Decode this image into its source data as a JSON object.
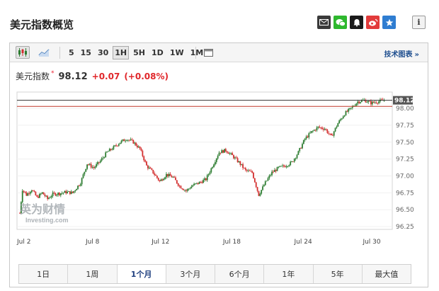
{
  "header": {
    "title": "美元指数概览"
  },
  "share_icons": [
    "email-icon",
    "wechat-icon",
    "notification-bell-icon",
    "weibo-icon",
    "favorite-star-icon"
  ],
  "info_label": "i",
  "toolbar": {
    "chart_type_icons": [
      "candlestick-icon",
      "line-chart-icon"
    ],
    "intervals": [
      "5",
      "15",
      "30",
      "1H",
      "5H",
      "1D",
      "1W",
      "1M"
    ],
    "active_interval": "1H",
    "tech_link": "技术图表",
    "tech_link_arrow": "»"
  },
  "quote": {
    "name": "美元指数",
    "marker": "*",
    "price": "98.12",
    "change": "+0.07",
    "change_pct": "(+0.08%)",
    "change_color": "#e0262a"
  },
  "watermark": {
    "line1": "英为财情",
    "line2": "Investing.com"
  },
  "range_buttons": [
    "1日",
    "1周",
    "1个月",
    "3个月",
    "6个月",
    "1年",
    "5年",
    "最大值"
  ],
  "active_range": "1个月",
  "colors": {
    "up": "#2e7d32",
    "down": "#d32f2f",
    "current_line": "#333333",
    "prev_close_line": "#c0392b",
    "price_tag": "#555555"
  },
  "chart_data": {
    "type": "candlestick",
    "xlabels": [
      "Jul 2",
      "Jul 8",
      "Jul 12",
      "Jul 18",
      "Jul 24",
      "Jul 30"
    ],
    "y_ticks": [
      "98.00",
      "97.75",
      "97.50",
      "97.25",
      "97.00",
      "96.75",
      "96.50",
      "96.25"
    ],
    "ylim": [
      96.25,
      98.2
    ],
    "current_price": "98.12",
    "prev_close": 98.03,
    "series": [
      {
        "t": 0,
        "v": 96.45
      },
      {
        "t": 2,
        "v": 96.8
      },
      {
        "t": 5,
        "v": 96.72
      },
      {
        "t": 9,
        "v": 96.8
      },
      {
        "t": 13,
        "v": 96.68
      },
      {
        "t": 17,
        "v": 96.75
      },
      {
        "t": 21,
        "v": 96.66
      },
      {
        "t": 25,
        "v": 96.73
      },
      {
        "t": 30,
        "v": 96.74
      },
      {
        "t": 35,
        "v": 96.76
      },
      {
        "t": 40,
        "v": 96.75
      },
      {
        "t": 46,
        "v": 96.9
      },
      {
        "t": 51,
        "v": 97.18
      },
      {
        "t": 56,
        "v": 97.12
      },
      {
        "t": 61,
        "v": 97.22
      },
      {
        "t": 66,
        "v": 97.35
      },
      {
        "t": 71,
        "v": 97.42
      },
      {
        "t": 76,
        "v": 97.5
      },
      {
        "t": 81,
        "v": 97.55
      },
      {
        "t": 86,
        "v": 97.5
      },
      {
        "t": 91,
        "v": 97.4
      },
      {
        "t": 96,
        "v": 97.15
      },
      {
        "t": 101,
        "v": 97.05
      },
      {
        "t": 106,
        "v": 96.92
      },
      {
        "t": 111,
        "v": 97.02
      },
      {
        "t": 116,
        "v": 96.98
      },
      {
        "t": 121,
        "v": 96.85
      },
      {
        "t": 126,
        "v": 96.78
      },
      {
        "t": 131,
        "v": 96.86
      },
      {
        "t": 136,
        "v": 96.9
      },
      {
        "t": 141,
        "v": 96.95
      },
      {
        "t": 146,
        "v": 97.15
      },
      {
        "t": 151,
        "v": 97.35
      },
      {
        "t": 156,
        "v": 97.38
      },
      {
        "t": 161,
        "v": 97.3
      },
      {
        "t": 166,
        "v": 97.2
      },
      {
        "t": 171,
        "v": 97.08
      },
      {
        "t": 176,
        "v": 97.05
      },
      {
        "t": 181,
        "v": 96.72
      },
      {
        "t": 186,
        "v": 96.9
      },
      {
        "t": 191,
        "v": 97.05
      },
      {
        "t": 196,
        "v": 97.12
      },
      {
        "t": 201,
        "v": 97.15
      },
      {
        "t": 206,
        "v": 97.2
      },
      {
        "t": 211,
        "v": 97.35
      },
      {
        "t": 216,
        "v": 97.55
      },
      {
        "t": 221,
        "v": 97.65
      },
      {
        "t": 226,
        "v": 97.72
      },
      {
        "t": 231,
        "v": 97.7
      },
      {
        "t": 236,
        "v": 97.58
      },
      {
        "t": 241,
        "v": 97.78
      },
      {
        "t": 246,
        "v": 97.92
      },
      {
        "t": 251,
        "v": 98.0
      },
      {
        "t": 256,
        "v": 98.1
      },
      {
        "t": 261,
        "v": 98.12
      },
      {
        "t": 266,
        "v": 98.08
      },
      {
        "t": 271,
        "v": 98.1
      },
      {
        "t": 276,
        "v": 98.12
      }
    ]
  }
}
